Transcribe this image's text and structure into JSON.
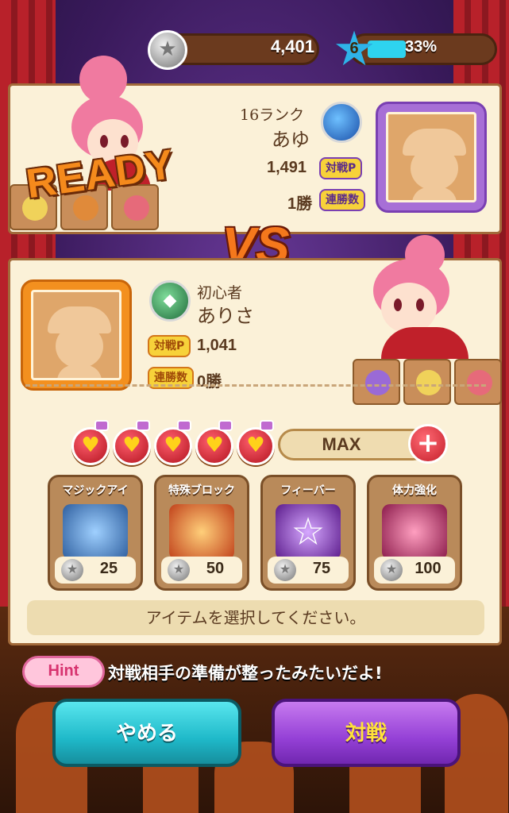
{
  "header": {
    "coins": "4,401",
    "level": "6",
    "xp_percent": "33%",
    "xp_fraction": 0.33
  },
  "opponent": {
    "rank_label": "16ランク",
    "name": "あゆ",
    "battle_points": "1,491",
    "battle_points_tag": "対戦P",
    "win_streak": "1勝",
    "win_streak_tag": "連勝数",
    "rank_icon": "moon-icon"
  },
  "ready_label": "READY",
  "vs_label": "VS",
  "player": {
    "rank_label": "初心者",
    "name": "ありさ",
    "battle_points": "1,041",
    "battle_points_tag": "対戦P",
    "win_streak": "0勝",
    "win_streak_tag": "連勝数",
    "rank_icon": "gem-icon"
  },
  "stamina": {
    "hearts": 5,
    "status": "MAX",
    "plus_label": "+"
  },
  "items": [
    {
      "label": "マジックアイ",
      "price": "25",
      "icon": "magnifier-icon",
      "color": "#4a86c4"
    },
    {
      "label": "特殊ブロック",
      "price": "50",
      "icon": "special-block-icon",
      "color": "#e0662a"
    },
    {
      "label": "フィーバー",
      "price": "75",
      "icon": "star-icon",
      "color": "#8a3ac0"
    },
    {
      "label": "体力強化",
      "price": "100",
      "icon": "potion-icon",
      "color": "#c03a6a"
    }
  ],
  "select_message": "アイテムを選択してください。",
  "hint": {
    "label": "Hint",
    "text": "対戦相手の準備が整ったみたいだよ!"
  },
  "buttons": {
    "cancel_label": "やめる",
    "battle_label": "対戦"
  },
  "colors": {
    "panel": "#fbf1d8",
    "accent_orange": "#f3901f",
    "accent_purple": "#a76fd6",
    "cancel_button": "#1fb9c9",
    "battle_button": "#9440d6"
  }
}
